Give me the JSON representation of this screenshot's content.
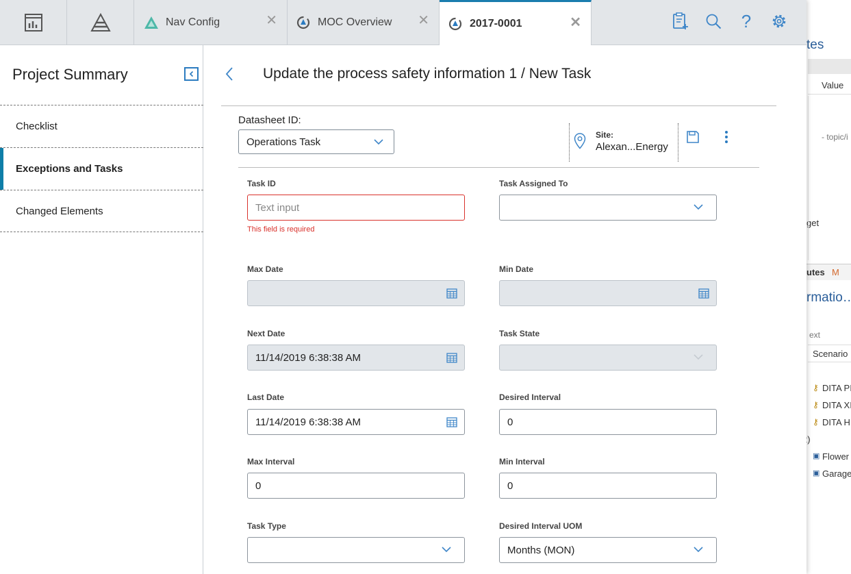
{
  "tabs": {
    "icon_tab_1": "dashboard-icon",
    "icon_tab_2": "pyramid-icon",
    "doc_tabs": [
      {
        "label": "Nav Config",
        "icon": "nav-config-icon"
      },
      {
        "label": "MOC Overview",
        "icon": "moc-icon"
      },
      {
        "label": "2017-0001",
        "icon": "moc-icon"
      }
    ],
    "close_glyph": "✕"
  },
  "toolbar": {
    "tools": [
      "clipboard-add-icon",
      "search-icon",
      "help-icon",
      "gear-icon"
    ],
    "help_glyph": "?"
  },
  "sidebar": {
    "title": "Project Summary",
    "items": [
      {
        "label": "Checklist"
      },
      {
        "label": "Exceptions and Tasks"
      },
      {
        "label": "Changed Elements"
      }
    ]
  },
  "main": {
    "heading": "Update the process safety information 1 / New Task",
    "datasheet_label": "Datasheet ID:",
    "datasheet_value": "Operations Task",
    "site_label": "Site:",
    "site_value": "Alexan...Energy"
  },
  "form": {
    "task_id": {
      "label": "Task ID",
      "placeholder": "Text input",
      "error": "This field is required"
    },
    "task_assigned_to": {
      "label": "Task Assigned To",
      "value": ""
    },
    "max_date": {
      "label": "Max Date",
      "value": ""
    },
    "min_date": {
      "label": "Min Date",
      "value": ""
    },
    "next_date": {
      "label": "Next Date",
      "value": "11/14/2019 6:38:38 AM"
    },
    "task_state": {
      "label": "Task State",
      "value": ""
    },
    "last_date": {
      "label": "Last Date",
      "value": "11/14/2019 6:38:38 AM"
    },
    "desired_interval": {
      "label": "Desired Interval",
      "value": "0"
    },
    "max_interval": {
      "label": "Max Interval",
      "value": "0"
    },
    "min_interval": {
      "label": "Min Interval",
      "value": "0"
    },
    "task_type": {
      "label": "Task Type",
      "value": ""
    },
    "desired_interval_uom": {
      "label": "Desired Interval UOM",
      "value": "Months (MON)"
    }
  },
  "background_app": {
    "texts": [
      "tes",
      "Value",
      "- topic/i",
      "get",
      "utes",
      "M",
      "rmatio…",
      "ext",
      "Scenario",
      "DITA PI",
      "DITA XI",
      "DITA H",
      "2)",
      "Flower",
      "Garage"
    ]
  },
  "colors": {
    "accent": "#1b7dae",
    "error": "#d9312b",
    "tab_bar": "#e3e6e9",
    "disabled_field": "#e2e6ea",
    "icon_blue": "#3f86c8"
  }
}
